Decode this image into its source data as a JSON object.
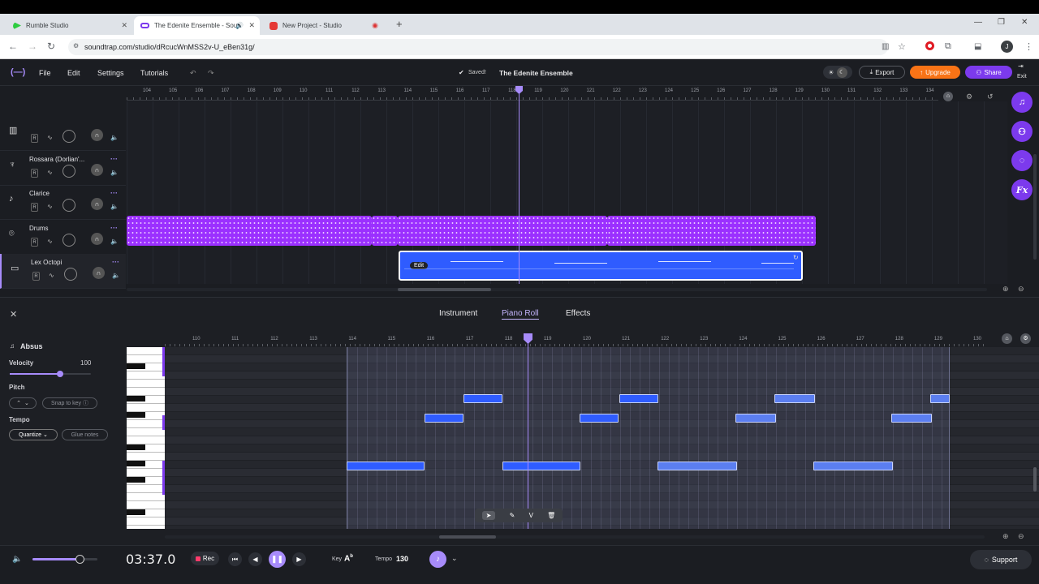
{
  "browser": {
    "tabs": [
      {
        "label": "Rumble Studio"
      },
      {
        "label": "The Edenite Ensemble - Sou"
      },
      {
        "label": "New Project - Studio"
      }
    ],
    "url": "soundtrap.com/studio/dRcucWnMSS2v-U_eBen31g/"
  },
  "menubar": {
    "file": "File",
    "edit": "Edit",
    "settings": "Settings",
    "tutorials": "Tutorials",
    "saved": "Saved!",
    "project_title": "The Edenite Ensemble",
    "export": "Export",
    "upgrade": "Upgrade",
    "share": "Share",
    "exit": "Exit"
  },
  "timeline": {
    "bars": [
      "104",
      "105",
      "106",
      "107",
      "108",
      "109",
      "110",
      "111",
      "112",
      "113",
      "114",
      "115",
      "116",
      "117",
      "118",
      "119",
      "120",
      "121",
      "122",
      "123",
      "124",
      "125",
      "126",
      "127",
      "128",
      "129",
      "130",
      "131",
      "132",
      "133",
      "134"
    ]
  },
  "tracks": [
    {
      "name": ""
    },
    {
      "name": "Rossara (Dorlian'..."
    },
    {
      "name": "Clarice"
    },
    {
      "name": "Drums"
    },
    {
      "name": "Lex Octopi"
    }
  ],
  "track_controls": {
    "record": "R"
  },
  "clip": {
    "edit_label": "Edit"
  },
  "sidebar": {
    "fx_label": "Fx"
  },
  "editor": {
    "tabs": {
      "instrument": "Instrument",
      "piano_roll": "Piano Roll",
      "effects": "Effects"
    },
    "instrument_name": "Absus",
    "velocity_label": "Velocity",
    "velocity_value": "100",
    "velocity": 0.62,
    "pitch_label": "Pitch",
    "snap_to_key": "Snap to key",
    "tempo_label": "Tempo",
    "quantize": "Quantize",
    "glue_notes": "Glue notes",
    "bars": [
      "110",
      "111",
      "112",
      "113",
      "114",
      "115",
      "116",
      "117",
      "118",
      "119",
      "120",
      "121",
      "122",
      "123",
      "124",
      "125",
      "126",
      "127",
      "128",
      "129",
      "130"
    ],
    "tool_v": "V"
  },
  "transport": {
    "time": "03:37.0",
    "rec": "Rec",
    "key_label": "Key",
    "key_value": "A",
    "key_accidental": "b",
    "tempo_label": "Tempo",
    "tempo_value": "130",
    "support": "Support",
    "volume": 0.72
  },
  "colors": {
    "accent": "#7c3aed",
    "upgrade": "#f97316",
    "drum_clip": "#9b30ff",
    "midi_clip": "#2f5cff"
  }
}
